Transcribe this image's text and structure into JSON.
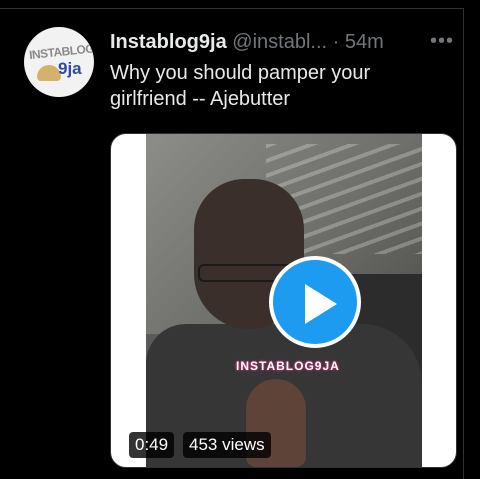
{
  "tweet": {
    "display_name": "Instablog9ja",
    "handle": "@instabl...",
    "separator": "·",
    "time": "54m",
    "more": "•••",
    "text": "Why you should pamper your girlfriend -- Ajebutter"
  },
  "avatar": {
    "logo_top": "INSTABLOG",
    "logo_bottom": "9ja"
  },
  "media": {
    "watermark": "INSTABLOG9JA",
    "duration": "0:49",
    "views": "453 views",
    "play_color": "#1d9bf0"
  }
}
